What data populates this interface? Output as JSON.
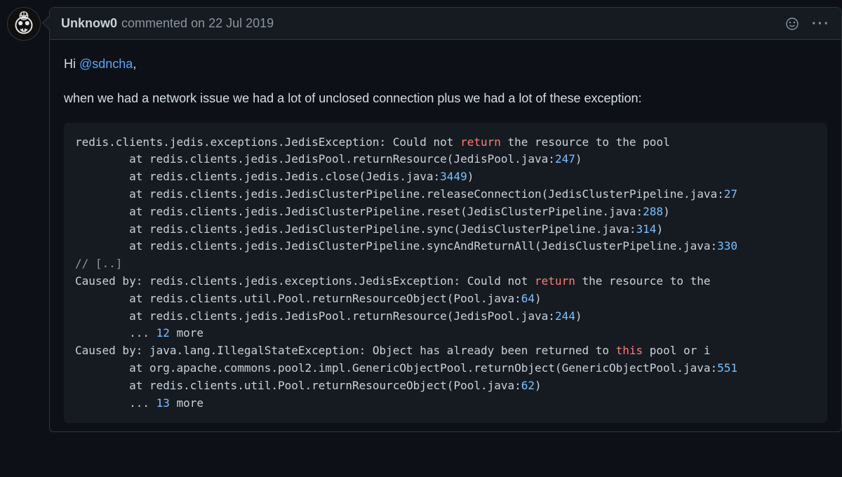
{
  "comment": {
    "author": "Unknow0",
    "action_text": "commented",
    "date_prefix": "on ",
    "date": "22 Jul 2019",
    "greeting_prefix": "Hi ",
    "mention": "@sdncha",
    "greeting_suffix": ",",
    "body_paragraph": "when we had a network issue we had a lot of unclosed connection plus we had a lot of these exception:",
    "code_lines": [
      [
        {
          "t": "redis.clients.jedis.exceptions.JedisException: Could not "
        },
        {
          "t": "return",
          "c": "tok-kw"
        },
        {
          "t": " the resource to the pool"
        }
      ],
      [
        {
          "t": "        at redis.clients.jedis.JedisPool.returnResource(JedisPool.java:"
        },
        {
          "t": "247",
          "c": "tok-num"
        },
        {
          "t": ")"
        }
      ],
      [
        {
          "t": "        at redis.clients.jedis.Jedis.close(Jedis.java:"
        },
        {
          "t": "3449",
          "c": "tok-num"
        },
        {
          "t": ")"
        }
      ],
      [
        {
          "t": "        at redis.clients.jedis.JedisClusterPipeline.releaseConnection(JedisClusterPipeline.java:"
        },
        {
          "t": "27",
          "c": "tok-num"
        }
      ],
      [
        {
          "t": "        at redis.clients.jedis.JedisClusterPipeline.reset(JedisClusterPipeline.java:"
        },
        {
          "t": "288",
          "c": "tok-num"
        },
        {
          "t": ")"
        }
      ],
      [
        {
          "t": "        at redis.clients.jedis.JedisClusterPipeline.sync(JedisClusterPipeline.java:"
        },
        {
          "t": "314",
          "c": "tok-num"
        },
        {
          "t": ")"
        }
      ],
      [
        {
          "t": "        at redis.clients.jedis.JedisClusterPipeline.syncAndReturnAll(JedisClusterPipeline.java:"
        },
        {
          "t": "330",
          "c": "tok-num"
        }
      ],
      [
        {
          "t": "// [..]",
          "c": "tok-com"
        }
      ],
      [
        {
          "t": "Caused by: redis.clients.jedis.exceptions.JedisException: Could not "
        },
        {
          "t": "return",
          "c": "tok-kw"
        },
        {
          "t": " the resource to the"
        }
      ],
      [
        {
          "t": "        at redis.clients.util.Pool.returnResourceObject(Pool.java:"
        },
        {
          "t": "64",
          "c": "tok-num"
        },
        {
          "t": ")"
        }
      ],
      [
        {
          "t": "        at redis.clients.jedis.JedisPool.returnResource(JedisPool.java:"
        },
        {
          "t": "244",
          "c": "tok-num"
        },
        {
          "t": ")"
        }
      ],
      [
        {
          "t": "        ... "
        },
        {
          "t": "12",
          "c": "tok-num"
        },
        {
          "t": " more"
        }
      ],
      [
        {
          "t": "Caused by: java.lang.IllegalStateException: Object has already been returned to "
        },
        {
          "t": "this",
          "c": "tok-kw"
        },
        {
          "t": " pool or i"
        }
      ],
      [
        {
          "t": "        at org.apache.commons.pool2.impl.GenericObjectPool.returnObject(GenericObjectPool.java:"
        },
        {
          "t": "551",
          "c": "tok-num"
        }
      ],
      [
        {
          "t": "        at redis.clients.util.Pool.returnResourceObject(Pool.java:"
        },
        {
          "t": "62",
          "c": "tok-num"
        },
        {
          "t": ")"
        }
      ],
      [
        {
          "t": "        ... "
        },
        {
          "t": "13",
          "c": "tok-num"
        },
        {
          "t": " more"
        }
      ]
    ]
  },
  "icons": {
    "kebab": "···"
  }
}
